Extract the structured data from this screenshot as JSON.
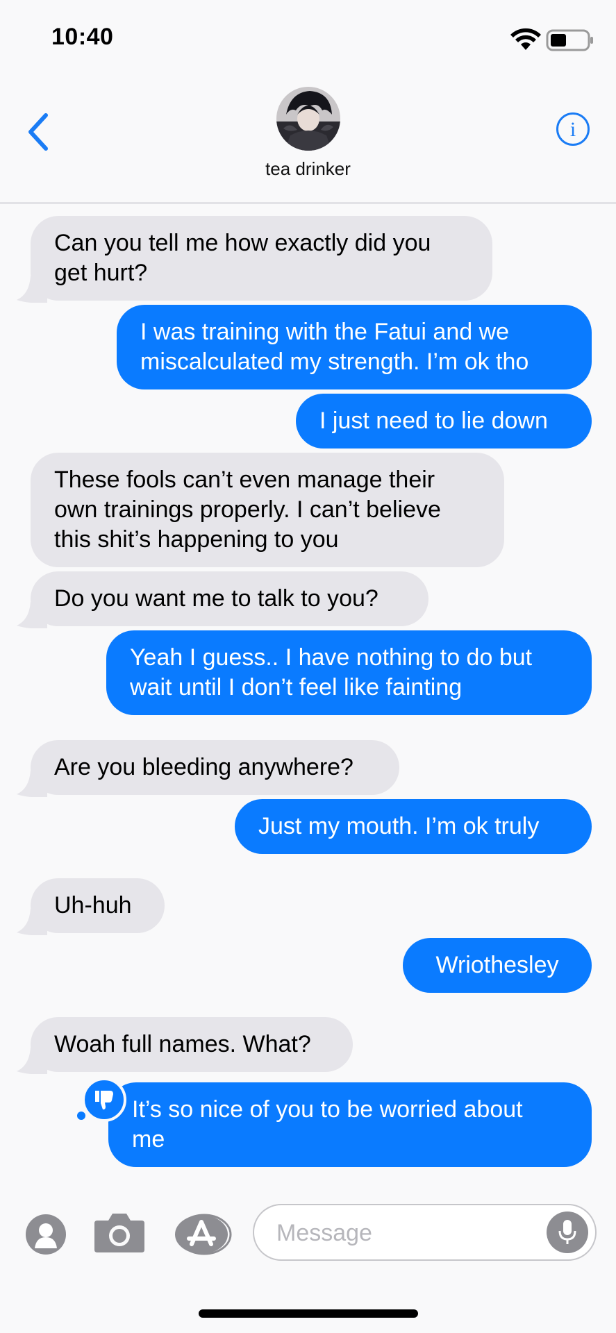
{
  "status": {
    "time": "10:40"
  },
  "header": {
    "contact_name": "tea drinker"
  },
  "messages": [
    {
      "from": "them",
      "text": "Can you tell me how exactly did you\nget hurt?"
    },
    {
      "from": "me",
      "text": "I was training with the Fatui and we\nmiscalculated my strength. I’m ok tho"
    },
    {
      "from": "me",
      "text": "I just need to lie down"
    },
    {
      "from": "them",
      "text": "These fools can’t even manage their\nown trainings properly. I can’t believe\nthis shit’s happening to you"
    },
    {
      "from": "them",
      "text": "Do you want me to talk to you?"
    },
    {
      "from": "me",
      "text": "Yeah I guess.. I have nothing to do but\nwait until I don’t feel like fainting"
    },
    {
      "from": "them",
      "text": "Are you bleeding anywhere?"
    },
    {
      "from": "me",
      "text": "Just my mouth. I’m ok truly"
    },
    {
      "from": "them",
      "text": "Uh-huh"
    },
    {
      "from": "me",
      "text": "Wriothesley"
    },
    {
      "from": "them",
      "text": "Woah full names. What?"
    },
    {
      "from": "me",
      "text": "It’s so nice of you to be worried about\nme",
      "reaction": "thumbs-down-icon"
    }
  ],
  "composer": {
    "placeholder": "Message"
  },
  "colors": {
    "bubble_out": "#0a7bff",
    "bubble_in": "#e6e5ea",
    "accent": "#1a7cf5"
  }
}
